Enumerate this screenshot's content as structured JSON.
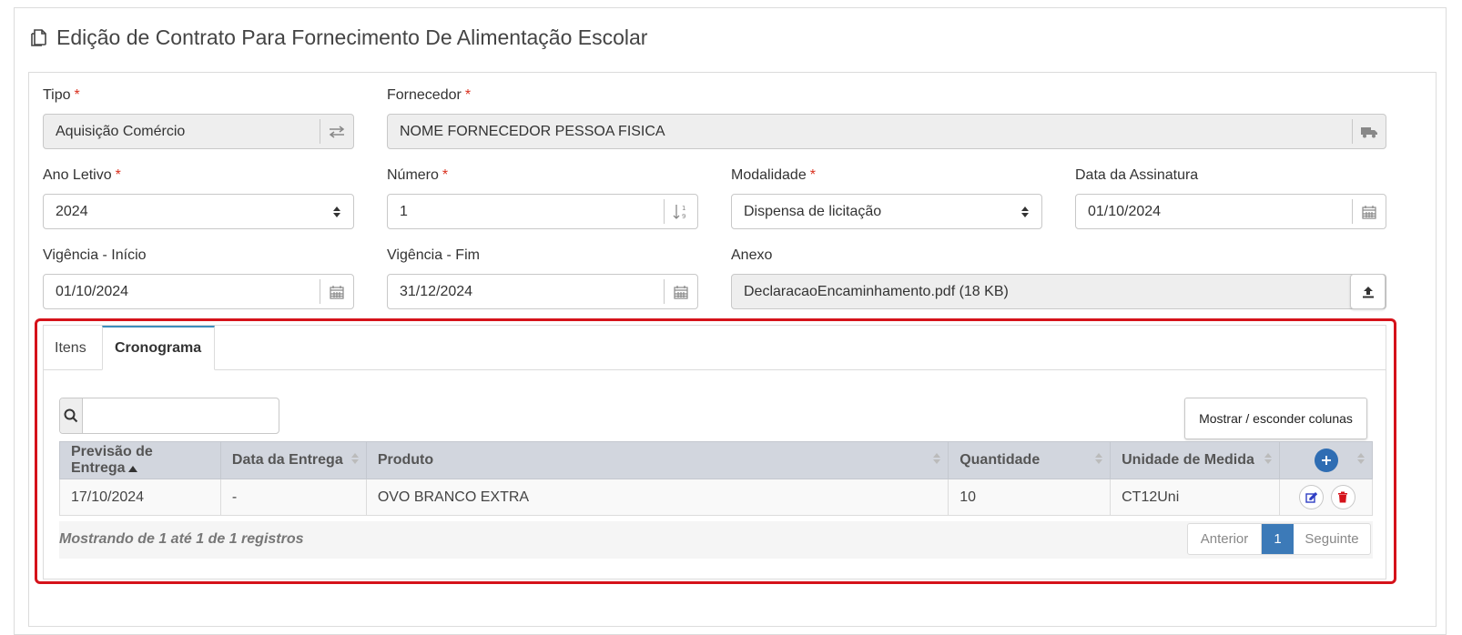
{
  "page_title": "Edição de Contrato Para Fornecimento De Alimentação Escolar",
  "form": {
    "tipo": {
      "label": "Tipo",
      "value": "Aquisição Comércio",
      "required_mark": "*"
    },
    "fornecedor": {
      "label": "Fornecedor",
      "value": "NOME FORNECEDOR PESSOA FISICA",
      "required_mark": "*"
    },
    "ano_letivo": {
      "label": "Ano Letivo",
      "value": "2024",
      "required_mark": "*"
    },
    "numero": {
      "label": "Número",
      "value": "1",
      "required_mark": "*"
    },
    "modalidade": {
      "label": "Modalidade",
      "value": "Dispensa de licitação",
      "required_mark": "*"
    },
    "data_assinatura": {
      "label": "Data da Assinatura",
      "value": "01/10/2024"
    },
    "vigencia_inicio": {
      "label": "Vigência - Início",
      "value": "01/10/2024"
    },
    "vigencia_fim": {
      "label": "Vigência - Fim",
      "value": "31/12/2024"
    },
    "anexo": {
      "label": "Anexo",
      "value": "DeclaracaoEncaminhamento.pdf (18 KB)"
    }
  },
  "tabs": [
    {
      "label": "Itens",
      "active": false
    },
    {
      "label": "Cronograma",
      "active": true
    }
  ],
  "search": {
    "placeholder": "",
    "value": ""
  },
  "columns_button": "Mostrar / esconder colunas",
  "table": {
    "headers": [
      "Previsão de Entrega",
      "Data da Entrega",
      "Produto",
      "Quantidade",
      "Unidade de Medida"
    ],
    "rows": [
      [
        "17/10/2024",
        "-",
        "OVO BRANCO EXTRA",
        "10",
        "CT12Uni"
      ]
    ]
  },
  "info_text": "Mostrando de 1 até 1 de 1 registros",
  "pagination": {
    "prev": "Anterior",
    "current": "1",
    "next": "Seguinte"
  },
  "colors": {
    "accent": "#3c7ab8",
    "highlight": "#d5121a",
    "required": "#d9301e",
    "header_bg": "#d2d6de"
  },
  "icons": [
    "copy-icon",
    "swap-icon",
    "truck-icon",
    "select-caret-icon",
    "numeric-sort-icon",
    "calendar-icon",
    "upload-icon",
    "search-icon",
    "plus-circle-icon",
    "edit-icon",
    "trash-icon",
    "sort-asc-icon",
    "sort-both-icon"
  ]
}
